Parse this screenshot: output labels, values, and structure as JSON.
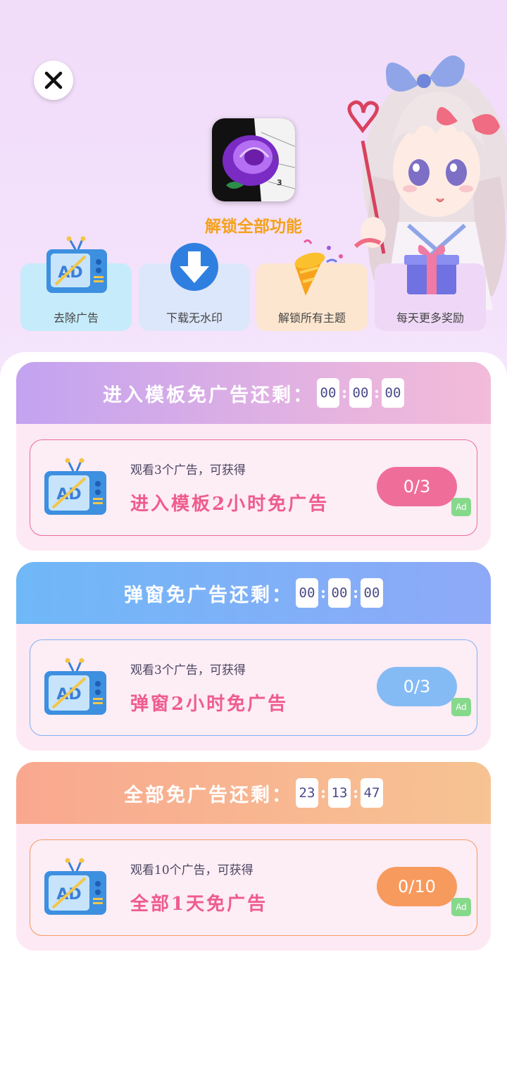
{
  "header": {
    "close_icon": "close-icon",
    "app_icon": "rose-paint-by-number-icon",
    "unlock_title": "解锁全部功能"
  },
  "features": [
    {
      "label": "去除广告",
      "icon": "ad-tv-icon"
    },
    {
      "label": "下载无水印",
      "icon": "download-arrow-icon"
    },
    {
      "label": "解锁所有主题",
      "icon": "party-popper-icon"
    },
    {
      "label": "每天更多奖励",
      "icon": "gift-box-icon"
    }
  ],
  "cards": [
    {
      "header": "进入模板免广告还剩：",
      "timer": [
        "00",
        "00",
        "00"
      ],
      "subtitle": "观看3个广告，可获得",
      "reward": "进入模板2小时免广告",
      "progress": "0/3",
      "ad_tag": "Ad",
      "color": "#ef6e99"
    },
    {
      "header": "弹窗免广告还剩：",
      "timer": [
        "00",
        "00",
        "00"
      ],
      "subtitle": "观看3个广告，可获得",
      "reward": "弹窗2小时免广告",
      "progress": "0/3",
      "ad_tag": "Ad",
      "color": "#85bbf5"
    },
    {
      "header": "全部免广告还剩：",
      "timer": [
        "23",
        "13",
        "47"
      ],
      "subtitle": "观看10个广告，可获得",
      "reward": "全部1天免广告",
      "progress": "0/10",
      "ad_tag": "Ad",
      "color": "#f79a5d"
    }
  ]
}
